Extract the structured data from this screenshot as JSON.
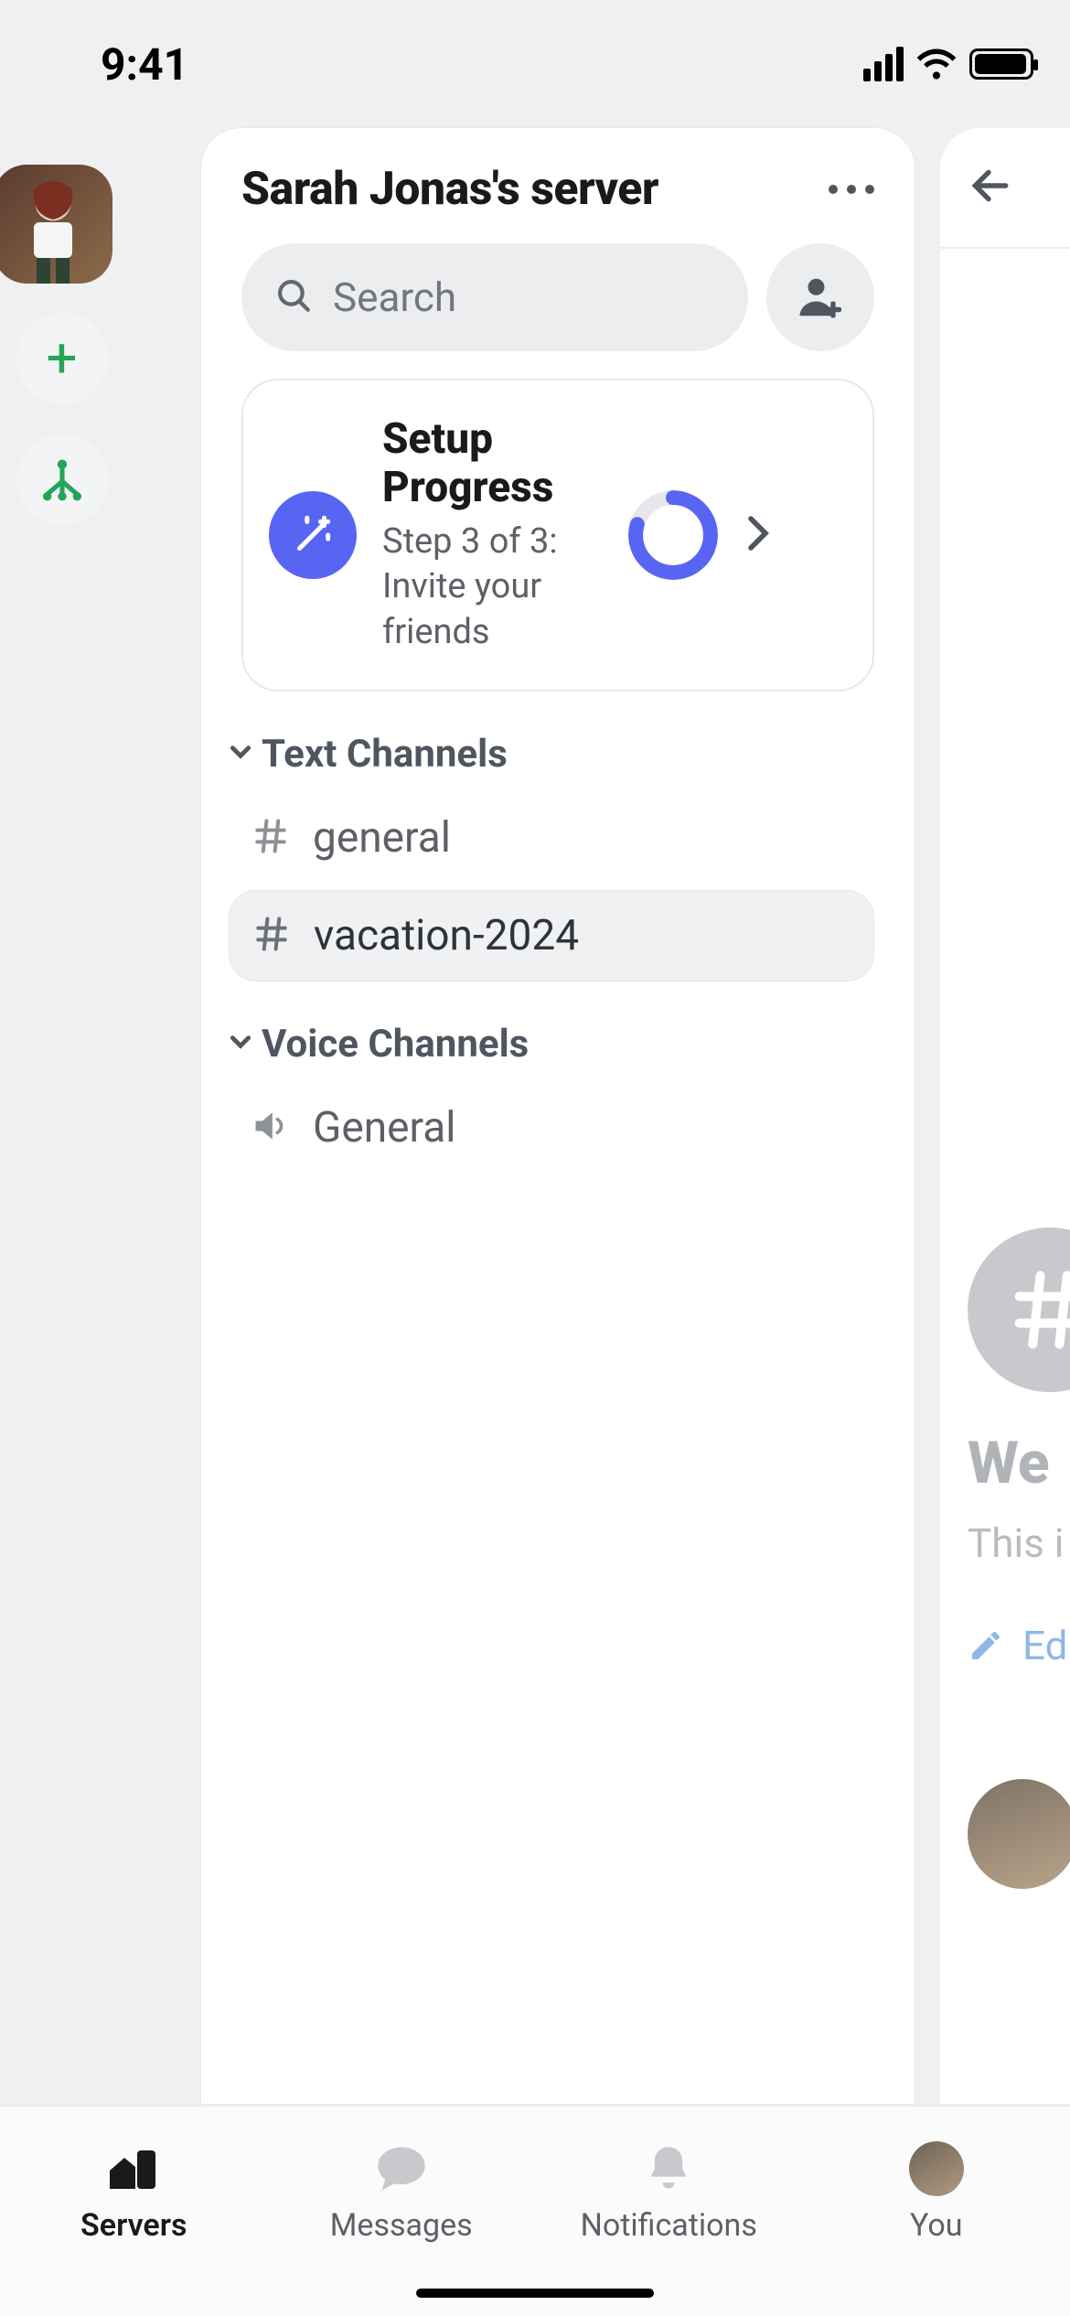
{
  "status": {
    "time": "9:41"
  },
  "server": {
    "title": "Sarah Jonas's server"
  },
  "search": {
    "placeholder": "Search"
  },
  "setup": {
    "title": "Setup Progress",
    "subtitle": "Step 3 of 3: Invite your friends",
    "progress_percent": 80
  },
  "sections": {
    "text": {
      "title": "Text Channels",
      "channels": [
        {
          "name": "general",
          "selected": false
        },
        {
          "name": "vacation-2024",
          "selected": true
        }
      ]
    },
    "voice": {
      "title": "Voice Channels",
      "channels": [
        {
          "name": "General"
        }
      ]
    }
  },
  "peek": {
    "welcome": "We",
    "subtitle": "This i",
    "edit": "Ed"
  },
  "tabs": {
    "servers": "Servers",
    "messages": "Messages",
    "notifications": "Notifications",
    "you": "You"
  },
  "icons": {
    "add_server": "plus-icon",
    "student_hub": "hub-icon",
    "search": "search-icon",
    "invite": "person-plus-icon",
    "wand": "wand-icon",
    "more": "more-icon",
    "back": "back-icon",
    "pencil": "pencil-icon"
  }
}
